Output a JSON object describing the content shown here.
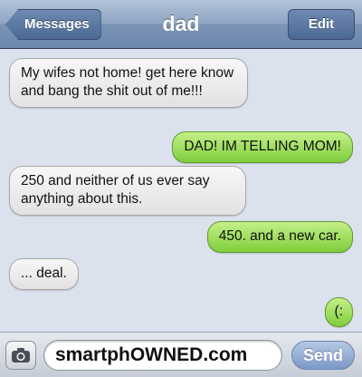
{
  "navbar": {
    "back_label": "Messages",
    "title": "dad",
    "edit_label": "Edit"
  },
  "messages": [
    {
      "direction": "incoming",
      "text": "My wifes not home! get here know and bang the shit out of me!!!"
    },
    {
      "direction": "outgoing",
      "text": "DAD! IM TELLING MOM!"
    },
    {
      "direction": "incoming",
      "text": "250 and neither of us ever say anything about this."
    },
    {
      "direction": "outgoing",
      "text": "450. and a new car."
    },
    {
      "direction": "incoming",
      "text": "... deal."
    },
    {
      "direction": "outgoing",
      "text": "(:"
    }
  ],
  "composer": {
    "input_value": "smartphOWNED.com",
    "send_label": "Send",
    "camera_icon": "camera-icon"
  },
  "colors": {
    "navbar": "#7a93b6",
    "background": "#dbe2ed",
    "incoming_bubble": "#e8e8e8",
    "outgoing_bubble": "#9ee05a"
  }
}
